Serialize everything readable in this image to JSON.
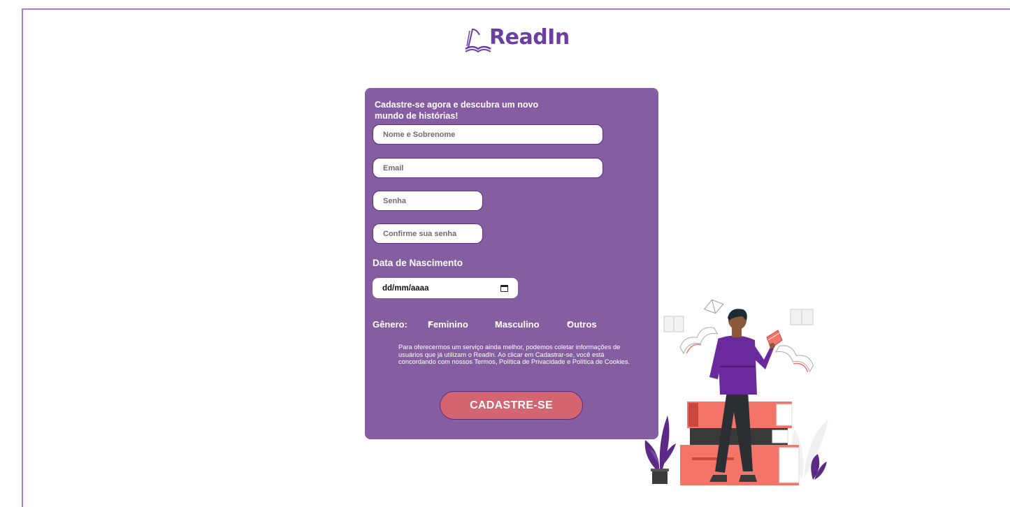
{
  "brand": {
    "name": "ReadIn"
  },
  "signup": {
    "title": "Cadastre-se agora e descubra um novo mundo de histórias!",
    "fields": {
      "name_placeholder": "Nome e Sobrenome",
      "email_placeholder": "Email",
      "password_placeholder": "Senha",
      "confirm_placeholder": "Confirme sua senha"
    },
    "birthdate": {
      "label": "Data de Nascimento",
      "value": "dd/mm/aaaa"
    },
    "gender": {
      "label": "Gênero:",
      "options": [
        "Feminino",
        "Masculino",
        "Outros"
      ]
    },
    "legal_text": "Para oferecermos um serviço ainda melhor, podemos coletar informações de usuários que já utilizam o ReadIn. Ao clicar em Cadastrar-se, você está concordando com nossos Termos, Política de Privacidade e Política de Cookies.",
    "submit_label": "CADASTRE-SE"
  },
  "colors": {
    "card": "#845ea1",
    "border": "#5b2e7e",
    "button": "#d4646f",
    "brand": "#6b3fa0"
  },
  "icons": {
    "logo": "open-book-icon",
    "date": "calendar-icon"
  }
}
